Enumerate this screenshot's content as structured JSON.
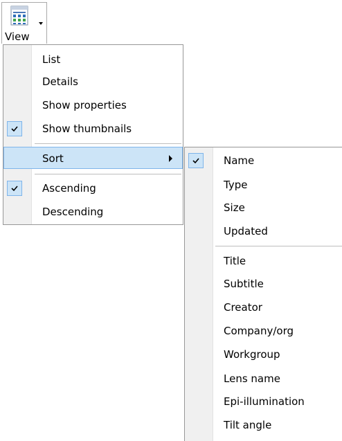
{
  "toolbar": {
    "view_label": "View",
    "view_icon": "view-grid-icon"
  },
  "view_menu": {
    "items": [
      {
        "label": "List",
        "checked": false
      },
      {
        "label": "Details",
        "checked": false
      },
      {
        "label": "Show properties",
        "checked": false
      },
      {
        "label": "Show thumbnails",
        "checked": true
      },
      {
        "label": "Sort",
        "checked": false,
        "has_submenu": true,
        "highlighted": true
      },
      {
        "label": "Ascending",
        "checked": true
      },
      {
        "label": "Descending",
        "checked": false
      }
    ]
  },
  "sort_menu": {
    "items": [
      {
        "label": "Name",
        "checked": true
      },
      {
        "label": "Type"
      },
      {
        "label": "Size"
      },
      {
        "label": "Updated"
      },
      {
        "label": "Title"
      },
      {
        "label": "Subtitle"
      },
      {
        "label": "Creator"
      },
      {
        "label": "Company/org"
      },
      {
        "label": "Workgroup"
      },
      {
        "label": "Lens name"
      },
      {
        "label": "Epi-illumination"
      },
      {
        "label": "Tilt angle"
      }
    ]
  },
  "colors": {
    "highlight_bg": "#cce4f7",
    "highlight_border": "#7eb4ea",
    "menu_border": "#979797"
  }
}
